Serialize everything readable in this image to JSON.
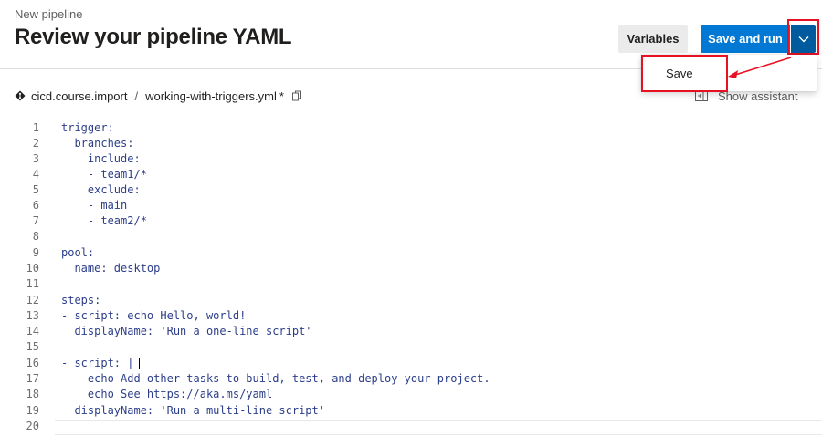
{
  "header": {
    "subtitle": "New pipeline",
    "title": "Review your pipeline YAML",
    "variables_label": "Variables",
    "save_and_run_label": "Save and run"
  },
  "dropdown": {
    "items": [
      {
        "label": "Save"
      }
    ]
  },
  "breadcrumb": {
    "repo": "cicd.course.import",
    "separator": "/",
    "file": "working-with-triggers.yml",
    "dirty_marker": "*"
  },
  "assistant": {
    "label": "Show assistant"
  },
  "editor": {
    "line_numbers": [
      "1",
      "2",
      "3",
      "4",
      "5",
      "6",
      "7",
      "8",
      "9",
      "10",
      "11",
      "12",
      "13",
      "14",
      "15",
      "16",
      "17",
      "18",
      "19",
      "20"
    ],
    "lines": [
      "trigger:",
      "  branches:",
      "    include:",
      "    - team1/*",
      "    exclude:",
      "    - main",
      "    - team2/*",
      "",
      "pool:",
      "  name: desktop",
      "",
      "steps:",
      "- script: echo Hello, world!",
      "  displayName: 'Run a one-line script'",
      "",
      "- script: |",
      "    echo Add other tasks to build, test, and deploy your project.",
      "    echo See https://aka.ms/yaml",
      "  displayName: 'Run a multi-line script'",
      ""
    ]
  },
  "colors": {
    "primary": "#0078d4",
    "primary_dark": "#005a9e",
    "annotation_red": "#e81123"
  },
  "icons": {
    "repo": "git-diamond-icon",
    "copy": "copy-icon",
    "assistant": "assistant-panel-icon",
    "chevron": "chevron-down-icon"
  }
}
